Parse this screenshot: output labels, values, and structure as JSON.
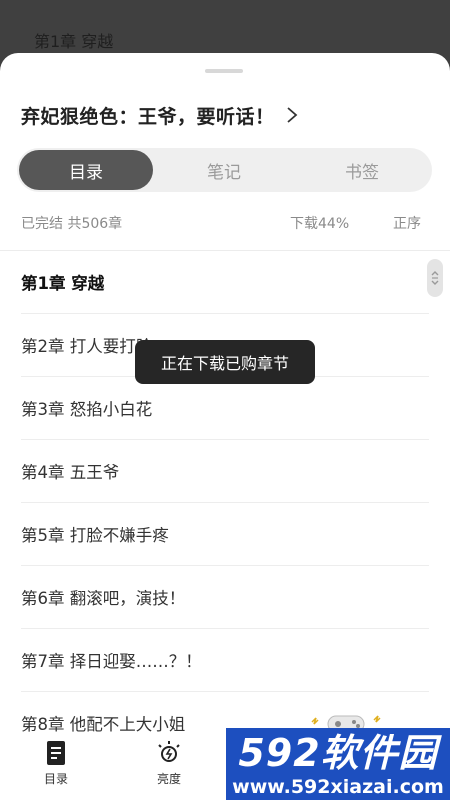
{
  "reader": {
    "chapter_title": "第1章 穿越"
  },
  "book": {
    "title": "弃妃狠绝色：王爷，要听话！"
  },
  "tabs": [
    {
      "label": "目录",
      "active": true
    },
    {
      "label": "笔记",
      "active": false
    },
    {
      "label": "书签",
      "active": false
    }
  ],
  "meta": {
    "status": "已完结 共506章",
    "download": "下载44%",
    "order": "正序"
  },
  "chapters": [
    {
      "title": "第1章 穿越",
      "current": true
    },
    {
      "title": "第2章 打人要打脸",
      "current": false
    },
    {
      "title": "第3章 怒掐小白花",
      "current": false
    },
    {
      "title": "第4章 五王爷",
      "current": false
    },
    {
      "title": "第5章 打脸不嫌手疼",
      "current": false
    },
    {
      "title": "第6章 翻滚吧，演技！",
      "current": false
    },
    {
      "title": "第7章 择日迎娶……？！",
      "current": false
    },
    {
      "title": "第8章 他配不上大小姐",
      "current": false
    }
  ],
  "toast": {
    "text": "正在下载已购章节"
  },
  "bottom_nav": [
    {
      "label": "目录",
      "icon": "book-icon"
    },
    {
      "label": "亮度",
      "icon": "brightness-icon"
    }
  ],
  "watermark": {
    "brand": "592软件园",
    "url": "www.592xiazai.com"
  },
  "colors": {
    "accent": "#575757",
    "watermark_blue": "#1d4fbf",
    "background": "#ffffff"
  }
}
